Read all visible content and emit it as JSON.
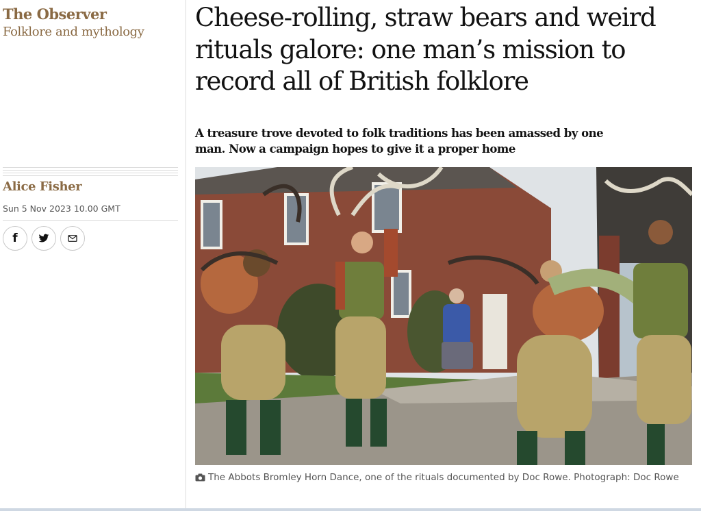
{
  "series": {
    "title": "The Observer",
    "subtitle": "Folklore and mythology"
  },
  "byline": {
    "author": "Alice Fisher",
    "date": "Sun 5 Nov 2023 10.00 GMT"
  },
  "share": [
    {
      "icon": "facebook-icon",
      "glyph": "f"
    },
    {
      "icon": "twitter-icon"
    },
    {
      "icon": "email-icon"
    }
  ],
  "article": {
    "headline": "Cheese-rolling, straw bears and weird rituals galore: one man’s mission to record all of British folklore",
    "standfirst": "A treasure trove devoted to folk traditions has been amassed by one man. Now a campaign hopes to give it a proper home",
    "image": {
      "caption": "The Abbots Bromley Horn Dance, one of the rituals documented by Doc Rowe. Photograph: Doc Rowe"
    }
  },
  "colors": {
    "accent": "#8a6a44",
    "text": "#121212",
    "muted": "#555555"
  }
}
